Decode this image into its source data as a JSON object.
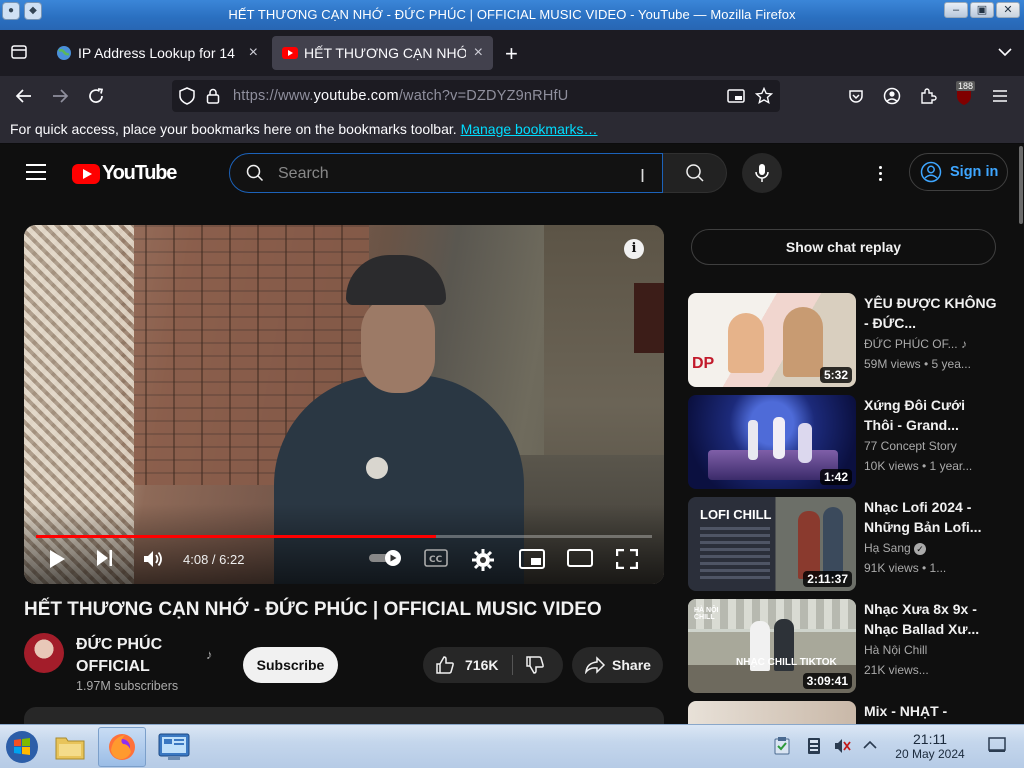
{
  "window": {
    "title": "HẾT THƯƠNG CẠN NHỚ - ĐỨC PHÚC | OFFICIAL MUSIC VIDEO - YouTube — Mozilla Firefox",
    "min_label": "–",
    "max_label": "▣",
    "close_label": "✕"
  },
  "tabs": [
    {
      "label": "IP Address Lookup for 14",
      "active": false
    },
    {
      "label": "HẾT THƯƠNG CẠN NHỚ",
      "active": true
    }
  ],
  "tab_close_glyph": "×",
  "new_tab_glyph": "+",
  "navbar": {
    "url_prefix": "https://www.",
    "url_domain": "youtube.com",
    "url_path": "/watch?v=DZDYZ9nRHfU",
    "extension_badge": "188"
  },
  "bookmarks": {
    "message": "For quick access, place your bookmarks here on the bookmarks toolbar.",
    "link": "Manage bookmarks…"
  },
  "youtube": {
    "logo_text": "YouTube",
    "search_placeholder": "Search",
    "sign_in": "Sign in",
    "player": {
      "current_time": "4:08",
      "duration": "6:22",
      "progress": 0.65
    },
    "video_title": "HẾT THƯƠNG CẠN NHỚ - ĐỨC PHÚC | OFFICIAL MUSIC VIDEO",
    "channel_name": "ĐỨC PHÚC OFFICIAL",
    "subscribers": "1.97M subscribers",
    "subscribe": "Subscribe",
    "likes": "716K",
    "share": "Share",
    "chat_replay": "Show chat replay",
    "recommendations": [
      {
        "title": "YÊU ĐƯỢC KHÔNG - ĐỨC...",
        "channel": "ĐỨC PHÚC OF...",
        "meta": "59M views • 5 yea...",
        "duration": "5:32"
      },
      {
        "title": "Xứng Đôi Cưới Thôi - Grand...",
        "channel": "77 Concept Story",
        "meta": "10K views • 1 year...",
        "duration": "1:42"
      },
      {
        "title": "Nhạc Lofi 2024 - Những Bản Lofi...",
        "channel": "Hạ Sang",
        "meta": "91K views • 1...",
        "duration": "2:11:37"
      },
      {
        "title": "Nhạc Xưa 8x 9x - Nhạc Ballad Xư...",
        "channel": "Hà Nội Chill",
        "meta": "21K views...",
        "duration": "3:09:41"
      },
      {
        "title": "Mix - NHẠT -",
        "channel": "",
        "meta": "",
        "duration": ""
      }
    ]
  },
  "taskbar": {
    "time": "21:11",
    "date": "20 May 2024"
  },
  "colors": {
    "yt_bg": "#0f0f0f",
    "accent_red": "#ff0000",
    "link_blue": "#3ea6ff"
  }
}
